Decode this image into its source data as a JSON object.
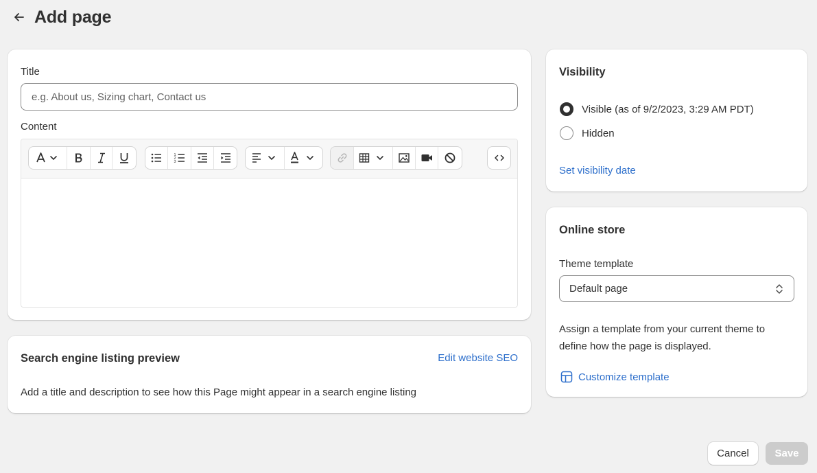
{
  "header": {
    "title": "Add page",
    "back_icon": "arrow-left-icon"
  },
  "main": {
    "title_label": "Title",
    "title_placeholder": "e.g. About us, Sizing chart, Contact us",
    "title_value": "",
    "content_label": "Content",
    "toolbar": {
      "groups": [
        [
          "font-style-icon",
          "bold-icon",
          "italic-icon",
          "underline-icon"
        ],
        [
          "bullet-list-icon",
          "numbered-list-icon",
          "outdent-icon",
          "indent-icon"
        ],
        [
          "align-icon",
          "text-color-icon"
        ],
        [
          "link-icon",
          "table-icon",
          "image-icon",
          "video-icon",
          "clear-format-icon"
        ],
        [
          "code-view-icon"
        ]
      ]
    }
  },
  "seo": {
    "title": "Search engine listing preview",
    "edit_link": "Edit website SEO",
    "description": "Add a title and description to see how this Page might appear in a search engine listing"
  },
  "visibility": {
    "title": "Visibility",
    "options": [
      {
        "label": "Visible (as of 9/2/2023, 3:29 AM PDT)",
        "checked": true
      },
      {
        "label": "Hidden",
        "checked": false
      }
    ],
    "set_date_link": "Set visibility date"
  },
  "online_store": {
    "title": "Online store",
    "template_label": "Theme template",
    "template_value": "Default page",
    "help_text": "Assign a template from your current theme to define how the page is displayed.",
    "customize_link": "Customize template"
  },
  "actions": {
    "cancel": "Cancel",
    "save": "Save"
  },
  "colors": {
    "accent_link": "#2c6ecb",
    "background": "#f1f1f1",
    "save_disabled": "#cccccc"
  }
}
